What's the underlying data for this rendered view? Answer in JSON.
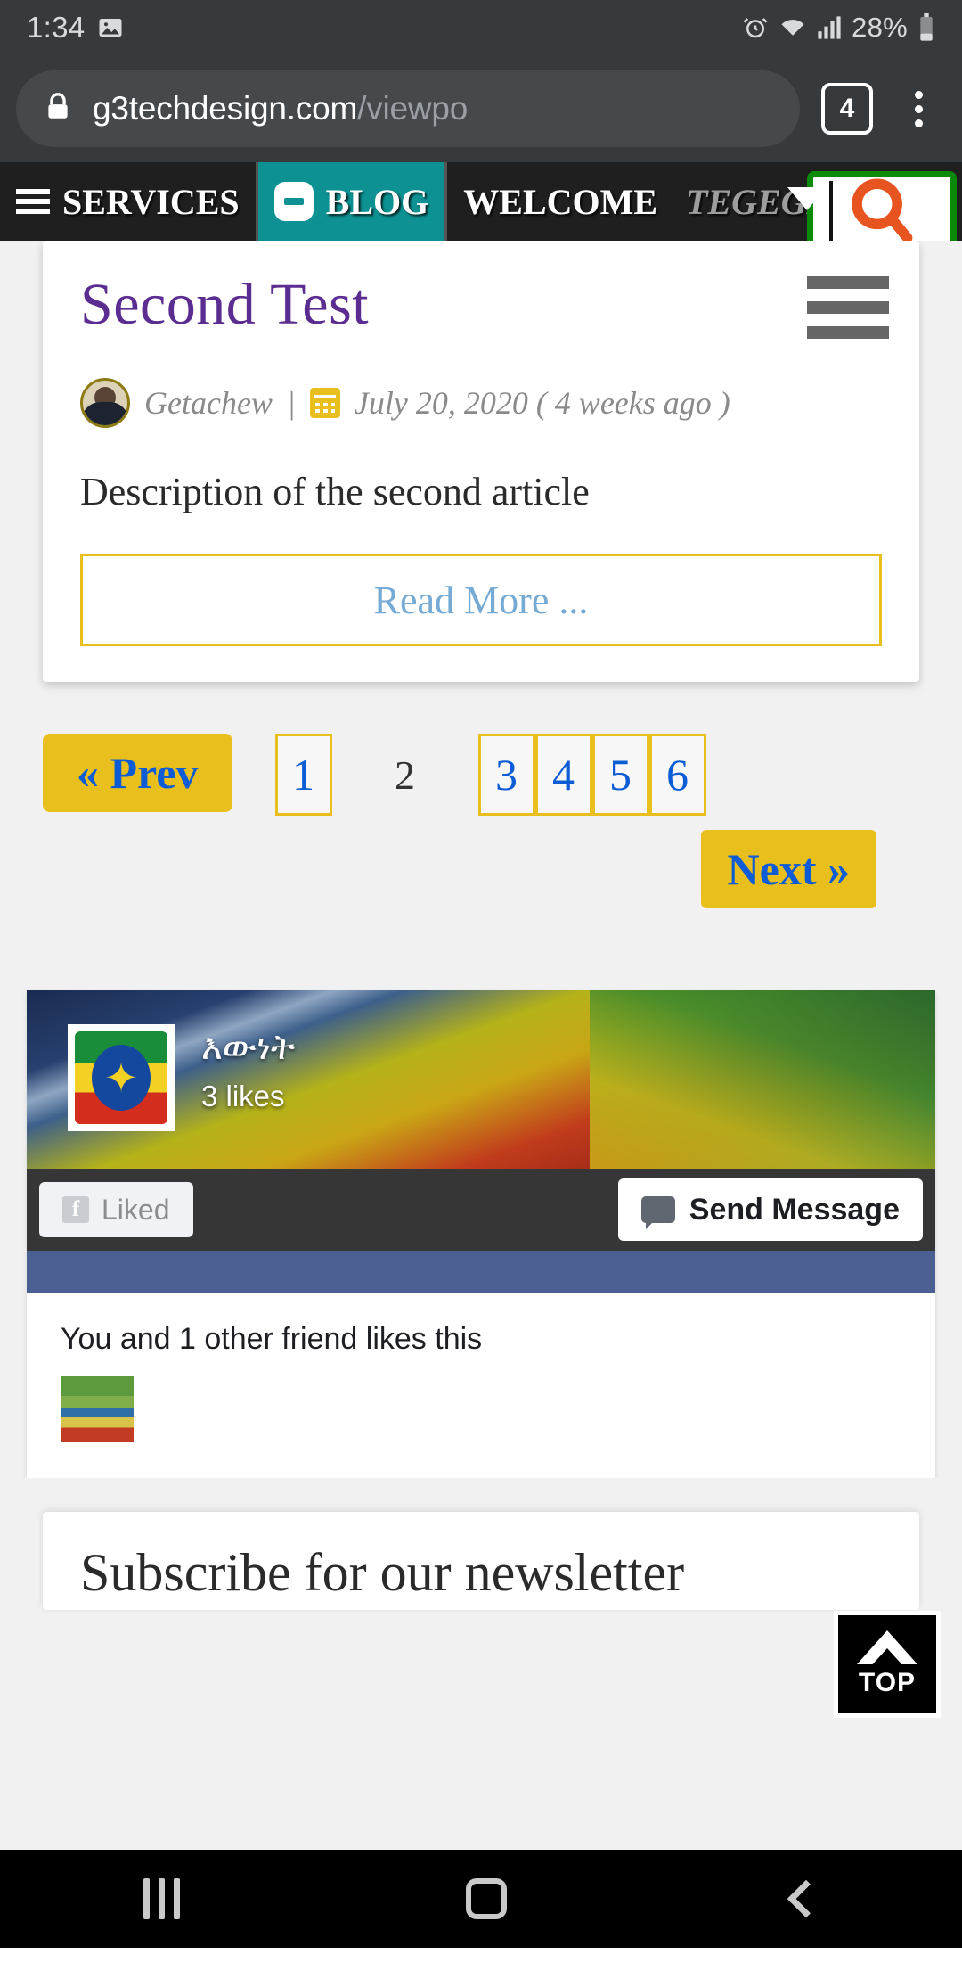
{
  "status_bar": {
    "time": "1:34",
    "battery_percent": "28%",
    "icons": [
      "image-icon",
      "alarm-icon",
      "wifi-icon",
      "cellular-signal-icon",
      "battery-icon"
    ]
  },
  "browser": {
    "url_domain": "g3techdesign.com",
    "url_path": "/viewpo",
    "tab_count": "4",
    "lock_icon": "lock-icon",
    "menu_icon": "overflow-menu-icon"
  },
  "site_nav": {
    "services": "SERVICES",
    "blog": "BLOG",
    "welcome": "WELCOME",
    "user": "TEGEGNE",
    "search_icon": "search-icon",
    "accent_teal": "#0d9192",
    "search_border": "#0a8a08",
    "search_icon_color": "#e8541f"
  },
  "article": {
    "title": "Second Test",
    "author": "Getachew",
    "separator": "|",
    "date": "July 20, 2020 ( 4 weeks ago )",
    "description": "Description of the second article",
    "read_more": "Read More ...",
    "title_color": "#5b2d90",
    "read_more_color": "#74aad4",
    "border_color": "#e8bf1d"
  },
  "pagination": {
    "prev": "« Prev",
    "next": "Next »",
    "pages": [
      {
        "label": "1",
        "current": false
      },
      {
        "label": "2",
        "current": true
      },
      {
        "label": "3",
        "current": false
      },
      {
        "label": "4",
        "current": false
      },
      {
        "label": "5",
        "current": false
      },
      {
        "label": "6",
        "current": false
      }
    ],
    "button_bg": "#e8bf1d",
    "link_color": "#0b5cd5"
  },
  "facebook_widget": {
    "page_name": "እውነት",
    "likes": "3 likes",
    "liked_button": "Liked",
    "send_message_button": "Send Message",
    "social_proof": "You and 1 other friend likes this",
    "logo_icon": "ethiopia-flag-icon",
    "facebook_icon": "facebook-f-icon",
    "message_icon": "message-bubble-icon"
  },
  "scroll_top": {
    "label": "TOP",
    "icon": "chevron-up-icon"
  },
  "teaser": {
    "title": "Subscribe for our newsletter"
  },
  "android_nav": {
    "recents": "recents-icon",
    "home": "home-icon",
    "back": "back-icon"
  }
}
